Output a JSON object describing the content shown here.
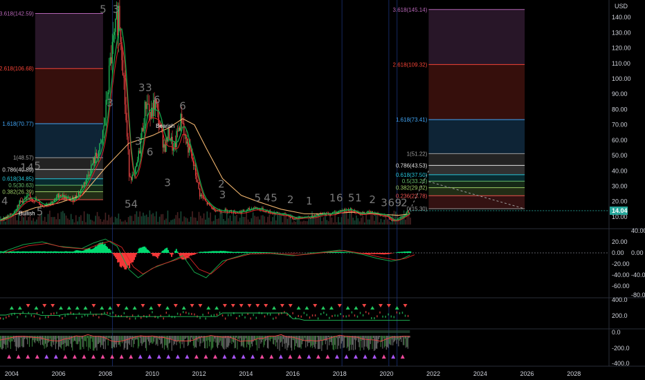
{
  "currency": "USD",
  "colors": {
    "background": "#000000",
    "up": "#22c55e",
    "down": "#ef4444",
    "slow_ma": "#f0b46e",
    "macd_up": "#00e676",
    "macd_down": "#ff3b3b",
    "last_price_bg": "#26a69a",
    "stochrsi_bg": "#3d8b5f"
  },
  "chart_data": [
    {
      "type": "candlestick",
      "title": "",
      "ylabel": "USD",
      "ylim": [
        5,
        150
      ],
      "yticks": [
        10,
        20,
        30,
        40,
        50,
        60,
        70,
        80,
        90,
        100,
        110,
        120,
        130,
        140
      ],
      "last_price": "14.04",
      "price_series": [
        [
          2003.5,
          8
        ],
        [
          2004.0,
          12
        ],
        [
          2004.3,
          19
        ],
        [
          2004.7,
          23
        ],
        [
          2005.0,
          21
        ],
        [
          2005.3,
          17
        ],
        [
          2005.5,
          19
        ],
        [
          2005.8,
          20
        ],
        [
          2006.0,
          25
        ],
        [
          2006.3,
          22
        ],
        [
          2006.6,
          21
        ],
        [
          2006.9,
          27
        ],
        [
          2007.2,
          36
        ],
        [
          2007.5,
          47
        ],
        [
          2007.8,
          56
        ],
        [
          2008.0,
          80
        ],
        [
          2008.2,
          112
        ],
        [
          2008.4,
          128
        ],
        [
          2008.55,
          145
        ],
        [
          2008.7,
          118
        ],
        [
          2008.85,
          75
        ],
        [
          2009.0,
          38
        ],
        [
          2009.2,
          35
        ],
        [
          2009.4,
          50
        ],
        [
          2009.6,
          72
        ],
        [
          2009.75,
          88
        ],
        [
          2009.9,
          74
        ],
        [
          2010.1,
          85
        ],
        [
          2010.3,
          70
        ],
        [
          2010.5,
          55
        ],
        [
          2010.7,
          65
        ],
        [
          2010.9,
          52
        ],
        [
          2011.1,
          68
        ],
        [
          2011.25,
          75
        ],
        [
          2011.4,
          60
        ],
        [
          2011.6,
          52
        ],
        [
          2011.8,
          40
        ],
        [
          2012.0,
          25
        ],
        [
          2012.3,
          19
        ],
        [
          2012.6,
          15
        ],
        [
          2012.9,
          14
        ],
        [
          2013.2,
          14
        ],
        [
          2013.6,
          13
        ],
        [
          2014.0,
          14
        ],
        [
          2014.3,
          16
        ],
        [
          2014.6,
          15
        ],
        [
          2015.0,
          13
        ],
        [
          2015.4,
          12
        ],
        [
          2015.8,
          11
        ],
        [
          2016.0,
          9
        ],
        [
          2016.4,
          10
        ],
        [
          2016.8,
          10
        ],
        [
          2017.2,
          12
        ],
        [
          2017.6,
          12
        ],
        [
          2018.0,
          14
        ],
        [
          2018.4,
          15
        ],
        [
          2018.8,
          12
        ],
        [
          2019.2,
          13
        ],
        [
          2019.6,
          12
        ],
        [
          2020.0,
          11
        ],
        [
          2020.2,
          7
        ],
        [
          2020.5,
          9
        ],
        [
          2020.8,
          12
        ],
        [
          2021.0,
          14.04
        ]
      ],
      "slow_ma": [
        [
          2003.5,
          8
        ],
        [
          2005.0,
          16
        ],
        [
          2006.0,
          19
        ],
        [
          2007.0,
          24
        ],
        [
          2008.0,
          42
        ],
        [
          2009.0,
          58
        ],
        [
          2010.0,
          63
        ],
        [
          2010.7,
          68
        ],
        [
          2011.3,
          74
        ],
        [
          2011.8,
          70
        ],
        [
          2012.3,
          55
        ],
        [
          2013.0,
          35
        ],
        [
          2013.8,
          24
        ],
        [
          2014.5,
          20
        ],
        [
          2015.5,
          15
        ],
        [
          2016.5,
          12
        ],
        [
          2017.5,
          12
        ],
        [
          2018.5,
          13
        ],
        [
          2019.5,
          12
        ],
        [
          2020.5,
          11
        ],
        [
          2021.0,
          12
        ]
      ],
      "fib_left": {
        "x_range": [
          2005.0,
          2007.9
        ],
        "levels": [
          {
            "ratio": "3.618",
            "price": "142.59",
            "value": 142.59,
            "label": "3.618(142.59)",
            "color": "#b565b5"
          },
          {
            "ratio": "2.618",
            "price": "106.68",
            "value": 106.68,
            "label": "2.618(106.68)",
            "color": "#f44336"
          },
          {
            "ratio": "1.618",
            "price": "70.77",
            "value": 70.77,
            "label": "1.618(70.77)",
            "color": "#42a5f5"
          },
          {
            "ratio": "1",
            "price": "48.57",
            "value": 48.57,
            "label": "1(48.57)",
            "color": "#9e9e9e"
          },
          {
            "ratio": "0.786",
            "price": "40.89",
            "value": 40.89,
            "label": "0.786(40.89)",
            "color": "#e0e0e0"
          },
          {
            "ratio": "0.618",
            "price": "34.85",
            "value": 34.85,
            "label": "0.618(34.85)",
            "color": "#26c6da"
          },
          {
            "ratio": "0.5",
            "price": "30.63",
            "value": 30.63,
            "label": "0.5(30.63)",
            "color": "#66bb6a"
          },
          {
            "ratio": "0.382",
            "price": "26.39",
            "value": 26.39,
            "label": "0.382(26.39)",
            "color": "#9ccc65"
          },
          {
            "ratio": "0.236",
            "price": "",
            "value": 21.2,
            "label": "0.236",
            "color": "#ef5350"
          }
        ]
      },
      "fib_right": {
        "x_range": [
          2021.8,
          2025.9
        ],
        "levels": [
          {
            "ratio": "3.618",
            "price": "145.14",
            "value": 145.14,
            "label": "3.618(145.14)",
            "color": "#b565b5"
          },
          {
            "ratio": "2.618",
            "price": "109.32",
            "value": 109.32,
            "label": "2.618(109.32)",
            "color": "#f44336"
          },
          {
            "ratio": "1.618",
            "price": "73.41",
            "value": 73.41,
            "label": "1.618(73.41)",
            "color": "#42a5f5"
          },
          {
            "ratio": "1",
            "price": "51.22",
            "value": 51.22,
            "label": "1(51.22)",
            "color": "#9e9e9e"
          },
          {
            "ratio": "0.786",
            "price": "43.53",
            "value": 43.53,
            "label": "0.786(43.53)",
            "color": "#e0e0e0"
          },
          {
            "ratio": "0.618",
            "price": "37.50",
            "value": 37.5,
            "label": "0.618(37.50)",
            "color": "#26c6da"
          },
          {
            "ratio": "0.5",
            "price": "33.26",
            "value": 33.26,
            "label": "0.5(33.26)",
            "color": "#66bb6a"
          },
          {
            "ratio": "0.382",
            "price": "29.02",
            "value": 29.02,
            "label": "0.382(29.02)",
            "color": "#9ccc65"
          },
          {
            "ratio": "0.236",
            "price": "23.78",
            "value": 23.78,
            "label": "0.236(23.78)",
            "color": "#ef5350"
          },
          {
            "ratio": "0",
            "price": "15.30",
            "value": 15.3,
            "label": "0(15.30)",
            "color": "#9e9e9e"
          }
        ]
      },
      "wave_labels": [
        {
          "text": "4",
          "x": 2003.7,
          "y": 18
        },
        {
          "text": "5",
          "x": 2007.9,
          "y": 143
        },
        {
          "text": "3",
          "x": 2008.45,
          "y": 143
        },
        {
          "text": "3",
          "x": 2008.2,
          "y": 82
        },
        {
          "text": "3",
          "x": 2009.55,
          "y": 92
        },
        {
          "text": "3",
          "x": 2009.85,
          "y": 92
        },
        {
          "text": "6",
          "x": 2010.2,
          "y": 84
        },
        {
          "text": "6",
          "x": 2011.3,
          "y": 80
        },
        {
          "text": "3",
          "x": 2009.4,
          "y": 57
        },
        {
          "text": "6",
          "x": 2009.9,
          "y": 50
        },
        {
          "text": "54",
          "x": 2009.1,
          "y": 16
        },
        {
          "text": "3",
          "x": 2010.65,
          "y": 30
        },
        {
          "text": "2",
          "x": 2012.95,
          "y": 29
        },
        {
          "text": "3",
          "x": 2013.0,
          "y": 22
        },
        {
          "text": "5",
          "x": 2014.5,
          "y": 20
        },
        {
          "text": "4",
          "x": 2014.9,
          "y": 20
        },
        {
          "text": "5",
          "x": 2015.2,
          "y": 20
        },
        {
          "text": "2",
          "x": 2015.9,
          "y": 19
        },
        {
          "text": "1",
          "x": 2016.7,
          "y": 18
        },
        {
          "text": "1",
          "x": 2017.7,
          "y": 20
        },
        {
          "text": "6",
          "x": 2018.0,
          "y": 20
        },
        {
          "text": "5",
          "x": 2018.5,
          "y": 20
        },
        {
          "text": "1",
          "x": 2018.8,
          "y": 20
        },
        {
          "text": "2",
          "x": 2019.4,
          "y": 19
        },
        {
          "text": "3",
          "x": 2019.9,
          "y": 17
        },
        {
          "text": "6",
          "x": 2020.2,
          "y": 17
        },
        {
          "text": "9",
          "x": 2020.5,
          "y": 17
        },
        {
          "text": "2",
          "x": 2020.75,
          "y": 17
        },
        {
          "text": "1",
          "x": 2004.5,
          "y": 40
        },
        {
          "text": "4",
          "x": 2004.8,
          "y": 40
        },
        {
          "text": "5",
          "x": 2005.1,
          "y": 41
        },
        {
          "text": "5",
          "x": 2005.2,
          "y": 11
        }
      ],
      "annotations": [
        {
          "text": "Bullish",
          "x": 2004.3,
          "y": 11
        },
        {
          "text": "Bearish",
          "x": 2010.15,
          "y": 68
        }
      ]
    },
    {
      "type": "histogram",
      "title": "",
      "ylim": [
        -80,
        40
      ],
      "ytick_labels_left": [
        "20.00",
        "0.00",
        "-20.00",
        "-40.00",
        "-60.00"
      ],
      "ytick_labels_right": [
        "40.00",
        "0.00",
        "-40.00",
        "-80.00"
      ],
      "hist": [
        [
          2006.6,
          3
        ],
        [
          2006.8,
          6
        ],
        [
          2007.0,
          4
        ],
        [
          2007.2,
          10
        ],
        [
          2007.4,
          7
        ],
        [
          2007.6,
          16
        ],
        [
          2007.8,
          23
        ],
        [
          2008.0,
          15
        ],
        [
          2008.2,
          5
        ],
        [
          2008.4,
          -10
        ],
        [
          2008.6,
          -25
        ],
        [
          2008.8,
          -35
        ],
        [
          2009.0,
          -28
        ],
        [
          2009.2,
          -15
        ],
        [
          2009.4,
          8
        ],
        [
          2009.6,
          15
        ],
        [
          2009.8,
          6
        ],
        [
          2010.0,
          -6
        ],
        [
          2010.2,
          -10
        ],
        [
          2010.4,
          4
        ],
        [
          2010.6,
          10
        ],
        [
          2010.8,
          -8
        ],
        [
          2011.0,
          8
        ],
        [
          2011.2,
          -12
        ],
        [
          2011.4,
          -14
        ],
        [
          2011.6,
          -6
        ],
        [
          2011.8,
          -3
        ],
        [
          2012.0,
          2
        ],
        [
          2012.4,
          3
        ],
        [
          2013.0,
          4
        ],
        [
          2013.4,
          2
        ],
        [
          2014.0,
          2
        ],
        [
          2015.0,
          1
        ],
        [
          2016.0,
          -1
        ],
        [
          2017.0,
          1
        ],
        [
          2018.0,
          2
        ],
        [
          2019.0,
          -2
        ],
        [
          2020.0,
          -3
        ],
        [
          2020.5,
          2
        ],
        [
          2021.0,
          3
        ]
      ],
      "line": [
        [
          2003.5,
          0
        ],
        [
          2004.5,
          15
        ],
        [
          2005.3,
          20
        ],
        [
          2006.0,
          12
        ],
        [
          2007.0,
          8
        ],
        [
          2007.5,
          18
        ],
        [
          2008.0,
          25
        ],
        [
          2008.5,
          12
        ],
        [
          2009.0,
          -30
        ],
        [
          2009.4,
          -45
        ],
        [
          2010.0,
          -28
        ],
        [
          2010.8,
          -15
        ],
        [
          2011.3,
          -5
        ],
        [
          2011.8,
          -35
        ],
        [
          2012.3,
          -45
        ],
        [
          2013.0,
          -15
        ],
        [
          2014.0,
          -2
        ],
        [
          2015.0,
          -1
        ],
        [
          2016.0,
          -5
        ],
        [
          2017.0,
          0
        ],
        [
          2018.0,
          5
        ],
        [
          2019.0,
          -3
        ],
        [
          2019.6,
          -10
        ],
        [
          2020.2,
          -15
        ],
        [
          2020.6,
          -12
        ],
        [
          2021.0,
          -4
        ]
      ]
    },
    {
      "type": "line",
      "title": "",
      "ylim": [
        -400,
        400
      ],
      "ytick_labels": [
        "400.0",
        "200.0",
        "0.0",
        "-200.0",
        "-400.0"
      ]
    }
  ],
  "x_axis": {
    "range": [
      2003.5,
      2029.5
    ],
    "ticks": [
      "2004",
      "2006",
      "2008",
      "2010",
      "2012",
      "2014",
      "2016",
      "2018",
      "2020",
      "2022",
      "2024",
      "2026",
      "2028"
    ]
  }
}
